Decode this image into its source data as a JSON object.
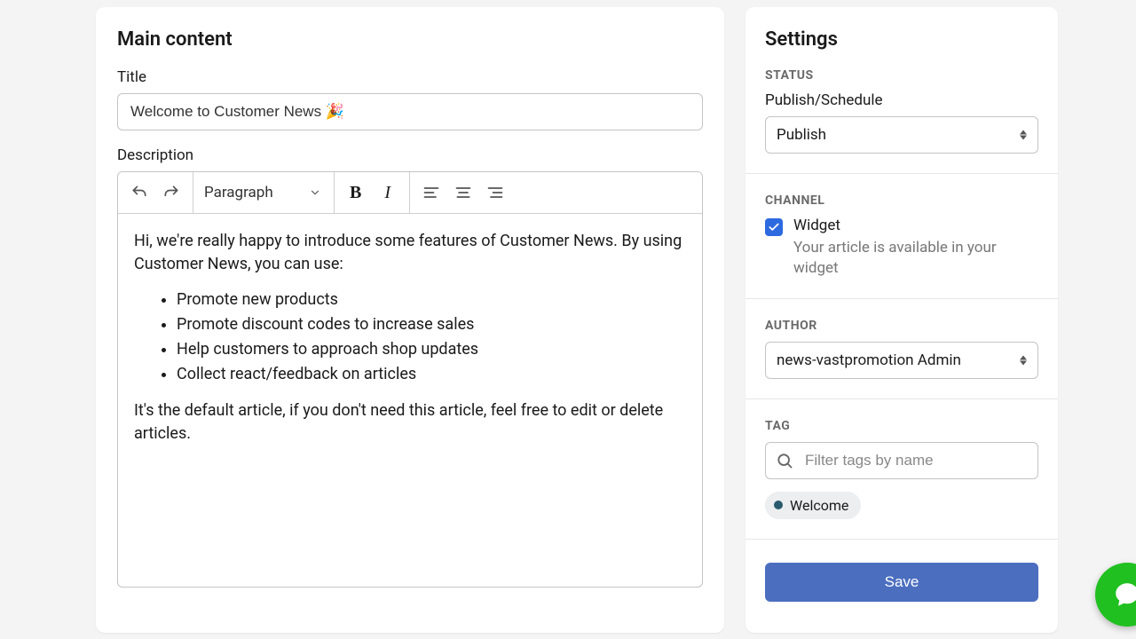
{
  "main": {
    "heading": "Main content",
    "title_label": "Title",
    "title_value": "Welcome to Customer News 🎉",
    "description_label": "Description",
    "toolbar": {
      "block_style": "Paragraph"
    },
    "body": {
      "intro": "Hi, we're really happy to introduce some features of Customer News. By using Customer News, you can use:",
      "bullets": [
        "Promote new products",
        "Promote discount codes to increase sales",
        "Help customers to approach shop updates",
        "Collect react/feedback on articles"
      ],
      "outro": "It's the default article, if you don't need this article, feel free to edit or delete articles."
    }
  },
  "settings": {
    "heading": "Settings",
    "status": {
      "section": "STATUS",
      "label": "Publish/Schedule",
      "value": "Publish"
    },
    "channel": {
      "section": "CHANNEL",
      "option_label": "Widget",
      "option_desc": "Your article is available in your widget"
    },
    "author": {
      "section": "AUTHOR",
      "value": "news-vastpromotion Admin"
    },
    "tag": {
      "section": "TAG",
      "placeholder": "Filter tags by name",
      "chips": [
        "Welcome"
      ]
    },
    "save_label": "Save"
  }
}
